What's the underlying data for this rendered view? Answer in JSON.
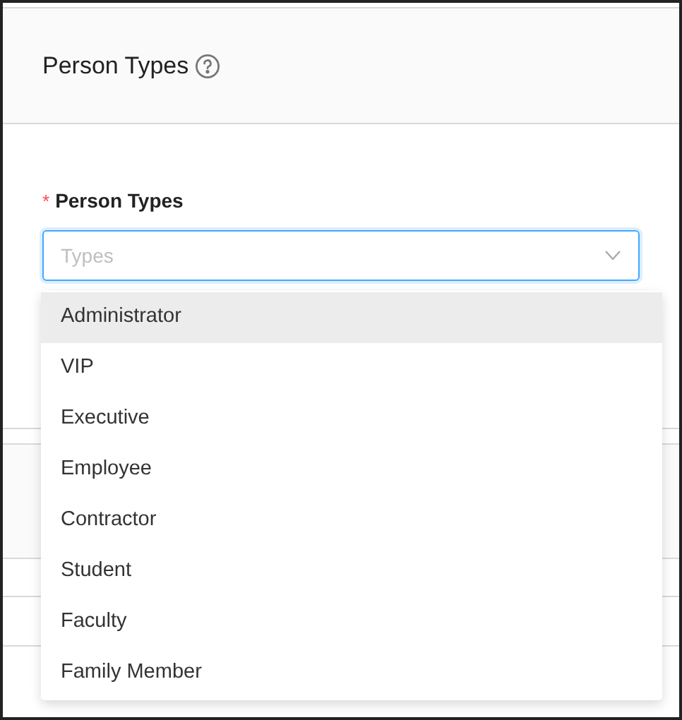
{
  "header": {
    "title": "Person Types"
  },
  "field": {
    "label": "Person Types",
    "required_mark": "*",
    "placeholder": "Types",
    "focused": true
  },
  "dropdown": {
    "options": [
      {
        "label": "Administrator",
        "selected": true
      },
      {
        "label": "VIP",
        "selected": false
      },
      {
        "label": "Executive",
        "selected": false
      },
      {
        "label": "Employee",
        "selected": false
      },
      {
        "label": "Contractor",
        "selected": false
      },
      {
        "label": "Student",
        "selected": false
      },
      {
        "label": "Faculty",
        "selected": false
      },
      {
        "label": "Family Member",
        "selected": false
      }
    ]
  }
}
